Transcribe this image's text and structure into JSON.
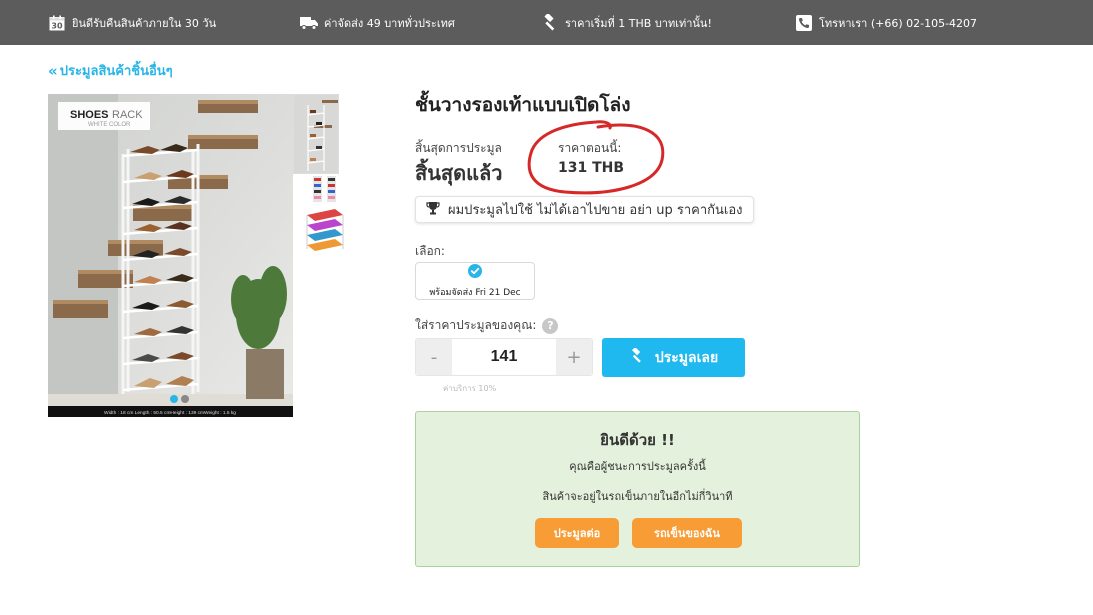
{
  "topbar": {
    "items": [
      {
        "icon": "calendar-icon",
        "label": "ยินดีรับคืนสินค้าภายใน 30 วัน"
      },
      {
        "icon": "truck-icon",
        "label": "ค่าจัดส่ง 49 บาททั่วประเทศ"
      },
      {
        "icon": "gavel-icon",
        "label": "ราคาเริ่มที่ 1 THB บาทเท่านั้น!"
      },
      {
        "icon": "phone-icon",
        "label": "โทรหาเรา (+66) 02-105-4207"
      }
    ],
    "calendar_number": "30"
  },
  "back_link": "ประมูลสินค้าชิ้นอื่นๆ",
  "gallery": {
    "brand": "SHOES",
    "brand_suffix": "RACK",
    "color_label": "WHITE COLOR",
    "dimensions": "Width : 18 cm Length : 50.5 cmHeight : 139 cmWeight : 1.5 kg"
  },
  "product": {
    "title": "ชั้นวางรองเท้าแบบเปิดโล่ง",
    "auction_end_label": "สิ้นสุดการประมูล",
    "auction_end_value": "สิ้นสุดแล้ว",
    "price_label": "ราคาตอนนี้:",
    "price_value": "131 THB",
    "note": "ผมประมูลไปใช้ ไม่ได้เอาไปขาย อย่า up ราคากันเอง",
    "choose_label": "เลือก:",
    "option_text": "พร้อมจัดส่ง Fri 21 Dec",
    "bid_label": "ใส่ราคาประมูลของคุณ:",
    "help_symbol": "?",
    "bid_value": "141",
    "minus": "-",
    "plus": "+",
    "bid_button": "ประมูลเลย",
    "fee_note": "ค่าบริการ 10%"
  },
  "win": {
    "title": "ยินดีด้วย !!",
    "line1": "คุณคือผู้ชนะการประมูลครั้งนี้",
    "line2": "สินค้าจะอยู่ในรถเข็นภายในอีกไม่กี่วินาที",
    "continue_button": "ประมูลต่อ",
    "cart_button": "รถเข็นของฉัน"
  },
  "colors": {
    "topbar_bg": "#5c5c5c",
    "accent_blue": "#1fb8ef",
    "link_blue": "#29b5e8",
    "orange": "#f89c35",
    "success_bg": "#e4f2dd",
    "annotation_red": "#d62828"
  }
}
